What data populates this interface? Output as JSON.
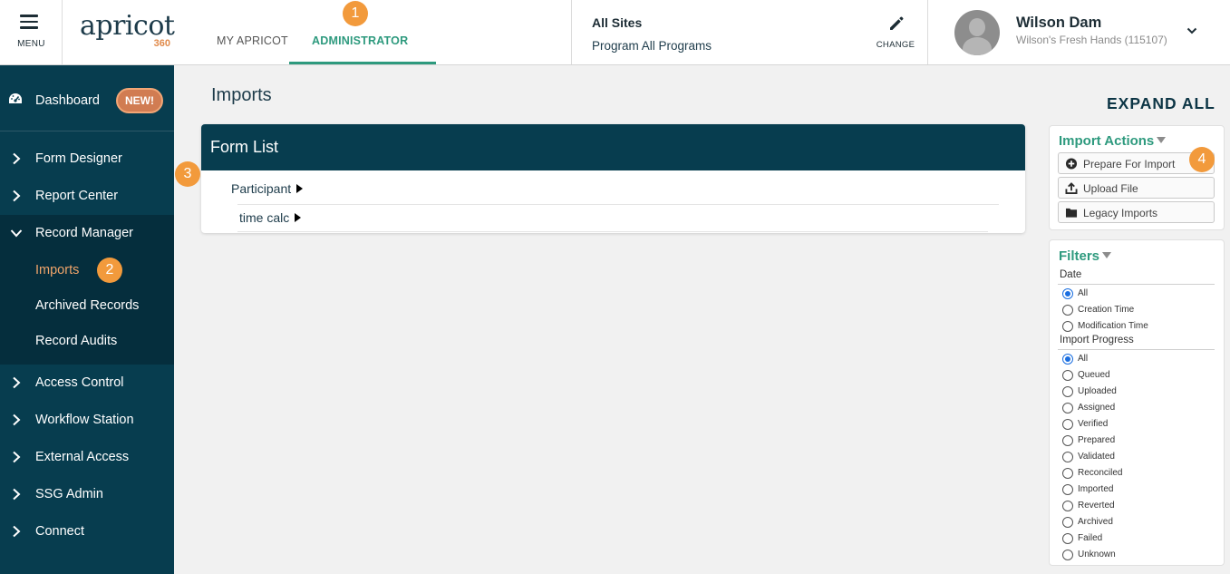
{
  "header": {
    "menu_label": "MENU",
    "logo_text": "apricot",
    "logo_sub": "360",
    "tabs": [
      {
        "label": "MY APRICOT",
        "active": false
      },
      {
        "label": "ADMINISTRATOR",
        "active": true
      }
    ],
    "site_title": "All Sites",
    "site_program": "Program All Programs",
    "change_label": "CHANGE",
    "user_name": "Wilson Dam",
    "user_org": "Wilson's Fresh Hands (115107)"
  },
  "sidebar": {
    "dashboard_label": "Dashboard",
    "new_badge": "NEW!",
    "items": [
      {
        "label": "Form Designer"
      },
      {
        "label": "Report Center"
      },
      {
        "label": "Record Manager"
      },
      {
        "label": "Access Control"
      },
      {
        "label": "Workflow Station"
      },
      {
        "label": "External Access"
      },
      {
        "label": "SSG Admin"
      },
      {
        "label": "Connect"
      }
    ],
    "subitems": [
      {
        "label": "Imports",
        "active": true
      },
      {
        "label": "Archived Records"
      },
      {
        "label": "Record Audits"
      }
    ]
  },
  "main": {
    "page_title": "Imports",
    "expand_all": "EXPAND ALL",
    "form_list_title": "Form List",
    "forms": [
      {
        "label": "Participant"
      },
      {
        "label": "time calc"
      }
    ]
  },
  "actions": {
    "title": "Import Actions",
    "buttons": [
      {
        "label": "Prepare For Import"
      },
      {
        "label": "Upload File"
      },
      {
        "label": "Legacy Imports"
      }
    ]
  },
  "filters": {
    "title": "Filters",
    "date_label": "Date",
    "date_options": [
      "All",
      "Creation Time",
      "Modification Time"
    ],
    "progress_label": "Import Progress",
    "progress_options": [
      "All",
      "Queued",
      "Uploaded",
      "Assigned",
      "Verified",
      "Prepared",
      "Validated",
      "Reconciled",
      "Imported",
      "Reverted",
      "Archived",
      "Failed",
      "Unknown"
    ]
  },
  "steps": [
    "1",
    "2",
    "3",
    "4"
  ],
  "colors": {
    "sidebar": "#073d4f",
    "accent_green": "#2e9a7e",
    "accent_orange": "#f29a3c"
  }
}
